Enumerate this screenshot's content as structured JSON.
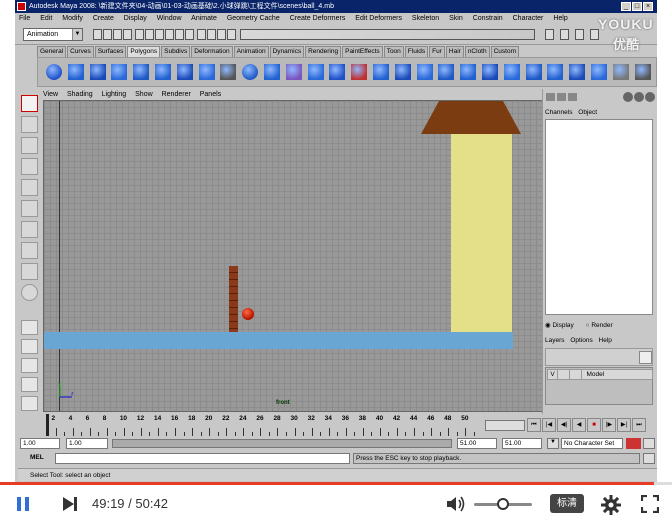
{
  "app": {
    "window_title": "Autodesk Maya 2008: \\新建文件夹\\04-动画\\01-03-动画基础\\2.小球弹跳\\工程文件\\scenes\\ball_4.mb",
    "menus": [
      "File",
      "Edit",
      "Modify",
      "Create",
      "Display",
      "Window",
      "Animate",
      "Geometry Cache",
      "Create Deformers",
      "Edit Deformers",
      "Skeleton",
      "Skin",
      "Constrain",
      "Character",
      "Help"
    ],
    "mode_select": "Animation",
    "shelf_tabs": [
      "General",
      "Curves",
      "Surfaces",
      "Polygons",
      "Subdivs",
      "Deformation",
      "Animation",
      "Dynamics",
      "Rendering",
      "PaintEffects",
      "Toon",
      "Fluids",
      "Fur",
      "Hair",
      "nCloth",
      "Custom"
    ],
    "active_shelf_tab": "Polygons",
    "viewport_menus": [
      "View",
      "Shading",
      "Lighting",
      "Show",
      "Renderer",
      "Panels"
    ],
    "camera_label": "front",
    "channel_box": {
      "tabs": [
        "Channels",
        "Object"
      ]
    },
    "layer_editor": {
      "radio_display": "Display",
      "radio_render": "Render",
      "menus": [
        "Layers",
        "Options",
        "Help"
      ],
      "layer": {
        "visible": "V",
        "name": "Model"
      }
    },
    "timeline": {
      "ticks": [
        "2",
        "4",
        "6",
        "8",
        "10",
        "12",
        "14",
        "16",
        "18",
        "20",
        "22",
        "24",
        "26",
        "28",
        "30",
        "32",
        "34",
        "36",
        "38",
        "40",
        "42",
        "44",
        "46",
        "48",
        "50"
      ]
    },
    "range": {
      "start": "1.00",
      "current": "1.00",
      "end": "51.00",
      "anim_end": "51.00",
      "character_set": "No Character Set"
    },
    "mel_label": "MEL",
    "command_feedback": "Press the ESC key to stop playback.",
    "help_line": "Select Tool: select an object"
  },
  "watermark": {
    "line1": "YOUKU",
    "line2": "优酷"
  },
  "player": {
    "current_time": "49:19",
    "total_time": "50:42",
    "progress": 0.973,
    "volume": 0.5,
    "quality_label": "标清",
    "accent_color": "#e53c24"
  }
}
